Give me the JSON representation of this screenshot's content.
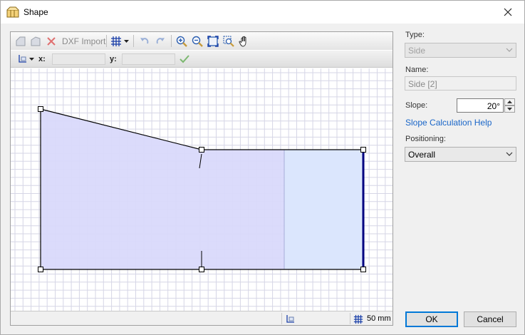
{
  "window": {
    "title": "Shape"
  },
  "toolbar": {
    "dxf_import_label": "DXF Import",
    "x_label": "x:",
    "y_label": "y:",
    "x_value": "",
    "y_value": ""
  },
  "status": {
    "grid_size": "50 mm"
  },
  "properties": {
    "type_label": "Type:",
    "type_value": "Side",
    "name_label": "Name:",
    "name_value": "Side [2]",
    "slope_label": "Slope:",
    "slope_value": "20°",
    "slope_help_link": "Slope Calculation Help",
    "positioning_label": "Positioning:",
    "positioning_value": "Overall"
  },
  "buttons": {
    "ok": "OK",
    "cancel": "Cancel"
  },
  "colors": {
    "shape_fill": "#d9d9fb",
    "shape_fill_light": "#dbe6fd",
    "grid_line": "#d6d6e6",
    "accent": "#0078d7",
    "link": "#1a66c8",
    "highlight_edge": "#000080"
  },
  "icons": [
    "shape-app-icon",
    "close-icon",
    "add-corner-icon",
    "remove-corner-icon",
    "delete-icon",
    "grid-icon",
    "undo-icon",
    "redo-icon",
    "zoom-in-icon",
    "zoom-out-icon",
    "zoom-fit-icon",
    "zoom-window-icon",
    "pan-hand-icon",
    "origin-icon",
    "apply-check-icon",
    "chevron-down-icon"
  ]
}
